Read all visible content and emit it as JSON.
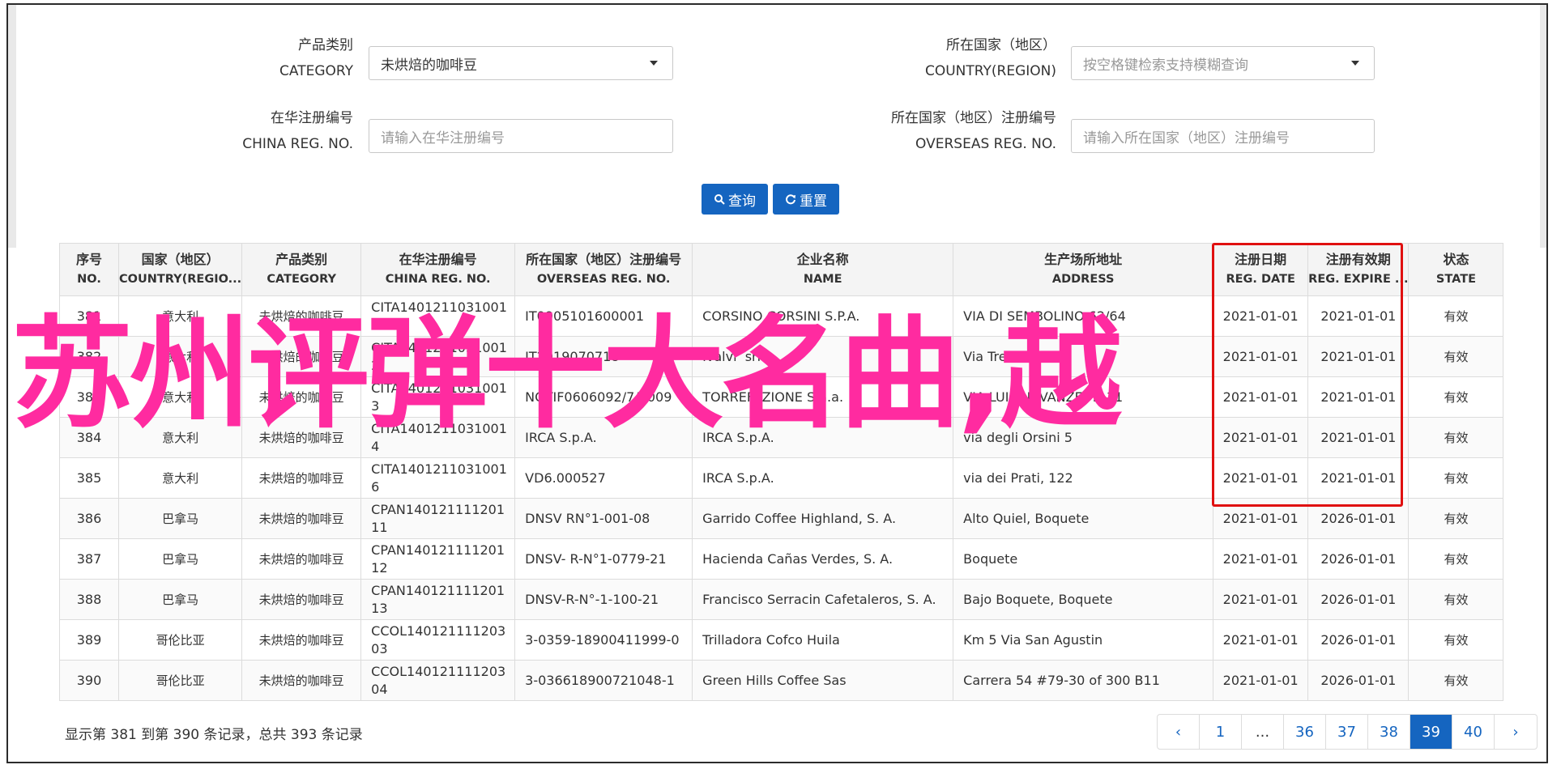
{
  "filters": {
    "category": {
      "label_zh": "产品类别",
      "label_en": "CATEGORY",
      "value": "未烘焙的咖啡豆"
    },
    "country": {
      "label_zh": "所在国家（地区）",
      "label_en": "COUNTRY(REGION)",
      "placeholder": "按空格键检索支持模糊查询"
    },
    "china_reg": {
      "label_zh": "在华注册编号",
      "label_en": "CHINA REG. NO.",
      "placeholder": "请输入在华注册编号"
    },
    "overseas_reg": {
      "label_zh": "所在国家（地区）注册编号",
      "label_en": "OVERSEAS REG. NO.",
      "placeholder": "请输入所在国家（地区）注册编号"
    },
    "search_label": "查询",
    "reset_label": "重置"
  },
  "table": {
    "headers": [
      {
        "zh": "序号",
        "en": "NO."
      },
      {
        "zh": "国家（地区）",
        "en": "COUNTRY(REGIO..."
      },
      {
        "zh": "产品类别",
        "en": "CATEGORY"
      },
      {
        "zh": "在华注册编号",
        "en": "CHINA REG. NO."
      },
      {
        "zh": "所在国家（地区）注册编号",
        "en": "OVERSEAS REG. NO."
      },
      {
        "zh": "企业名称",
        "en": "NAME"
      },
      {
        "zh": "生产场所地址",
        "en": "ADDRESS"
      },
      {
        "zh": "注册日期",
        "en": "REG. DATE"
      },
      {
        "zh": "注册有效期",
        "en": "REG. EXPIRE ..."
      },
      {
        "zh": "状态",
        "en": "STATE"
      }
    ],
    "rows": [
      [
        "381",
        "意大利",
        "未烘焙的咖啡豆",
        "CITA14012110310011",
        "IT0905101600001",
        "CORSINO CORSINI S.P.A.",
        "VIA DI SEMBOLINO 62/64",
        "2021-01-01",
        "2021-01-01",
        "有效"
      ],
      [
        "382",
        "意大利",
        "未烘焙的咖啡豆",
        "CITA14012110310012",
        "IT2019070718",
        "Ivalvi’ srl",
        "Via Trebbia 11",
        "2021-01-01",
        "2021-01-01",
        "有效"
      ],
      [
        "383",
        "意大利",
        "未烘焙的咖啡豆",
        "CITA14012110310013",
        "NOTIF0606092/7/2009",
        "TORREFAZIONE S.a.a.",
        "VIA LUIGI E VANZETTI 11",
        "2021-01-01",
        "2021-01-01",
        "有效"
      ],
      [
        "384",
        "意大利",
        "未烘焙的咖啡豆",
        "CITA14012110310014",
        "IRCA S.p.A.",
        "IRCA S.p.A.",
        "via degli Orsini 5",
        "2021-01-01",
        "2021-01-01",
        "有效"
      ],
      [
        "385",
        "意大利",
        "未烘焙的咖啡豆",
        "CITA14012110310016",
        "VD6.000527",
        "IRCA S.p.A.",
        "via dei Prati, 122",
        "2021-01-01",
        "2021-01-01",
        "有效"
      ],
      [
        "386",
        "巴拿马",
        "未烘焙的咖啡豆",
        "CPAN14012111120111",
        "DNSV RN°1-001-08",
        "Garrido Coffee Highland, S. A.",
        "Alto Quiel, Boquete",
        "2021-01-01",
        "2026-01-01",
        "有效"
      ],
      [
        "387",
        "巴拿马",
        "未烘焙的咖啡豆",
        "CPAN14012111120112",
        "DNSV- R-N°1-0779-21",
        "Hacienda Cañas Verdes, S. A.",
        "Boquete",
        "2021-01-01",
        "2026-01-01",
        "有效"
      ],
      [
        "388",
        "巴拿马",
        "未烘焙的咖啡豆",
        "CPAN14012111120113",
        "DNSV-R-N°-1-100-21",
        "Francisco Serracin Cafetaleros, S. A.",
        "Bajo Boquete, Boquete",
        "2021-01-01",
        "2026-01-01",
        "有效"
      ],
      [
        "389",
        "哥伦比亚",
        "未烘焙的咖啡豆",
        "CCOL14012111120303",
        "3-0359-18900411999-0",
        "Trilladora Cofco Huila",
        "Km 5 Via San Agustin",
        "2021-01-01",
        "2026-01-01",
        "有效"
      ],
      [
        "390",
        "哥伦比亚",
        "未烘焙的咖啡豆",
        "CCOL14012111120304",
        "3-036618900721048-1",
        "Green Hills Coffee Sas",
        "Carrera 54 #79-30 of 300 B11",
        "2021-01-01",
        "2026-01-01",
        "有效"
      ]
    ]
  },
  "overlay_text": "苏州评弹十大名曲,越",
  "summary": "显示第 381 到第 390 条记录，总共 393 条记录",
  "pagination": {
    "prev": "‹",
    "next": "›",
    "pages": [
      "1",
      "...",
      "36",
      "37",
      "38",
      "39",
      "40"
    ],
    "active": "39"
  },
  "colors": {
    "primary": "#1565c0",
    "highlight_box": "#e01010",
    "overlay": "#ff2ba0"
  }
}
